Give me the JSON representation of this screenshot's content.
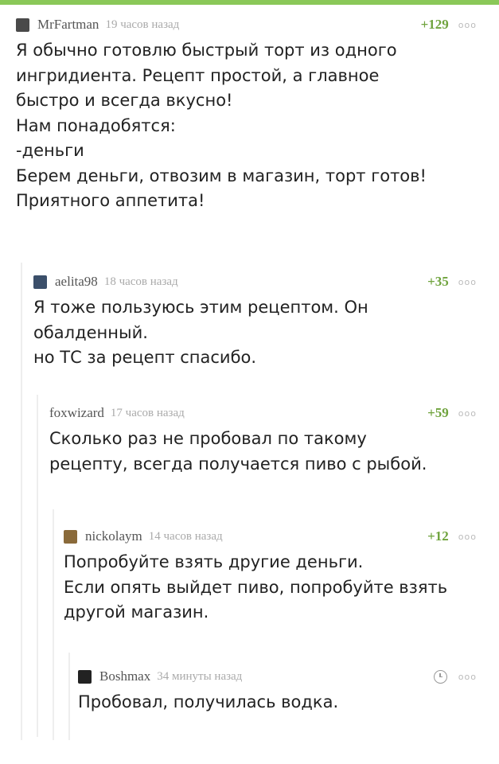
{
  "comments": [
    {
      "username": "MrFartman",
      "time": "19 часов назад",
      "rating": "+129",
      "more": "ooo",
      "avatar_color": "#4a4a4a",
      "lines": [
        "Я обычно готовлю быстрый торт из одного",
        "ингридиента. Рецепт простой, а главное",
        "быстро и всегда вкусно!",
        "Нам понадобятся:",
        "-деньги",
        "Берем деньги, отвозим в магазин, торт готов!",
        "Приятного аппетита!"
      ]
    },
    {
      "username": "aelita98",
      "time": "18 часов назад",
      "rating": "+35",
      "more": "ooo",
      "avatar_color": "#3b4f6a",
      "lines": [
        "Я тоже пользуюсь этим рецептом. Он",
        "обалденный.",
        "но ТС за рецепт спасибо."
      ]
    },
    {
      "username": "foxwizard",
      "time": "17 часов назад",
      "rating": "+59",
      "more": "ooo",
      "lines": [
        "Сколько раз не пробовал по такому",
        "рецепту, всегда получается пиво с рыбой."
      ]
    },
    {
      "username": "nickolaym",
      "time": "14 часов назад",
      "rating": "+12",
      "more": "ooo",
      "avatar_color": "#8a6a3a",
      "lines": [
        "Попробуйте взять другие деньги.",
        "Если опять выйдет пиво, попробуйте взять",
        "другой магазин."
      ]
    },
    {
      "username": "Boshmax",
      "time": "34 минуты назад",
      "more": "ooo",
      "avatar_color": "#222222",
      "lines": [
        "Пробовал, получилась водка."
      ]
    }
  ]
}
